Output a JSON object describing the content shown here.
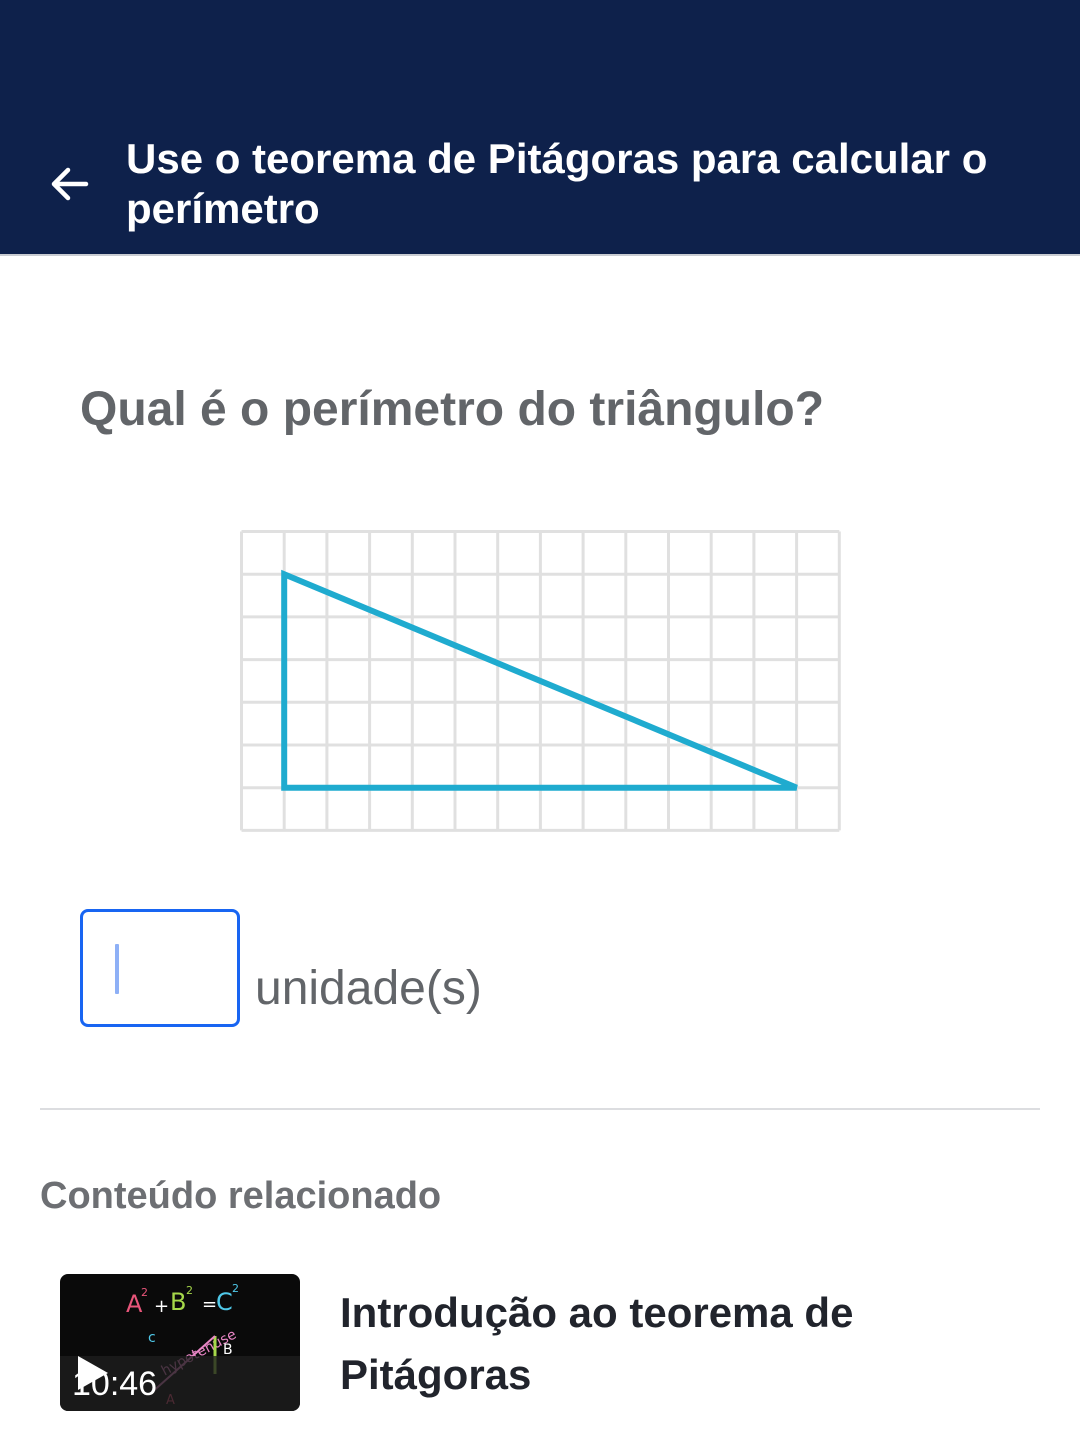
{
  "header": {
    "title": "Use o teorema de Pitágoras para calcular o perímetro",
    "back_icon": "arrow-left-icon",
    "background": "#0e214b"
  },
  "question": {
    "text": "Qual é o perímetro do triângulo?"
  },
  "figure": {
    "grid_columns": 14,
    "grid_rows": 7,
    "triangle_vertices_grid_units": [
      [
        1,
        1
      ],
      [
        1,
        6
      ],
      [
        13,
        6
      ]
    ],
    "triangle_color": "#1fabcf",
    "grid_color": "#e0e0e0"
  },
  "answer": {
    "value": "",
    "unit_label": "unidade(s)",
    "border_color": "#1865f2"
  },
  "related": {
    "heading": "Conteúdo relacionado",
    "items": [
      {
        "title": "Introdução ao teorema de Pitágoras",
        "duration": "10:46",
        "thumb_text": "A² + B² = C²",
        "thumb_label": "hypotenuse",
        "icon": "play-icon"
      }
    ]
  }
}
